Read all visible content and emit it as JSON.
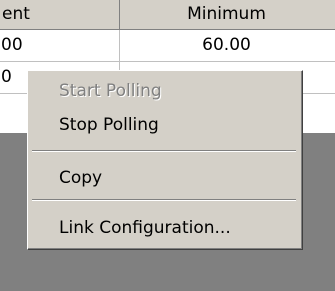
{
  "grid": {
    "columns": [
      "ent",
      "Minimum"
    ],
    "rows": [
      [
        "00",
        "60.00"
      ],
      [
        "0",
        ""
      ]
    ]
  },
  "context_menu": {
    "items": [
      {
        "label": "Start Polling",
        "enabled": false
      },
      {
        "label": "Stop Polling",
        "enabled": true
      },
      {
        "label": "Copy",
        "enabled": true
      },
      {
        "label": "Link Configuration...",
        "enabled": true
      }
    ]
  },
  "colors": {
    "menu_background": "#d4d0c8",
    "desktop_background": "#808080",
    "disabled_text": "#808080"
  }
}
